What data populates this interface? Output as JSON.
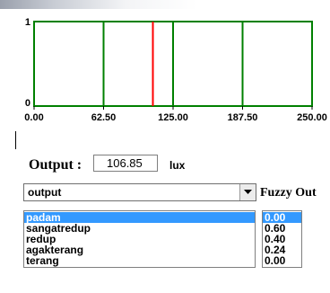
{
  "chart_data": {
    "type": "line",
    "x_ticks": [
      "0.00",
      "62.50",
      "125.00",
      "187.50",
      "250.00"
    ],
    "y_ticks": [
      "0",
      "1"
    ],
    "xlim": [
      0,
      250
    ],
    "ylim": [
      0,
      1
    ],
    "membership_lines": [
      {
        "x": 62.5,
        "color": "#008000"
      },
      {
        "x": 125.0,
        "color": "#008000"
      },
      {
        "x": 187.5,
        "color": "#008000"
      }
    ],
    "output_line": {
      "x": 106.85,
      "color": "#ff0000"
    },
    "frame_color": "#008000"
  },
  "output": {
    "label": "Output :",
    "value": "106.85",
    "unit": "lux"
  },
  "variable_select": {
    "selected": "output"
  },
  "fuzzy_label": "Fuzzy Out",
  "fuzzy_sets": [
    {
      "name": "padam",
      "value": "0.00",
      "selected": true
    },
    {
      "name": "sangatredup",
      "value": "0.60",
      "selected": false
    },
    {
      "name": "redup",
      "value": "0.40",
      "selected": false
    },
    {
      "name": "agakterang",
      "value": "0.24",
      "selected": false
    },
    {
      "name": "terang",
      "value": "0.00",
      "selected": false
    }
  ]
}
